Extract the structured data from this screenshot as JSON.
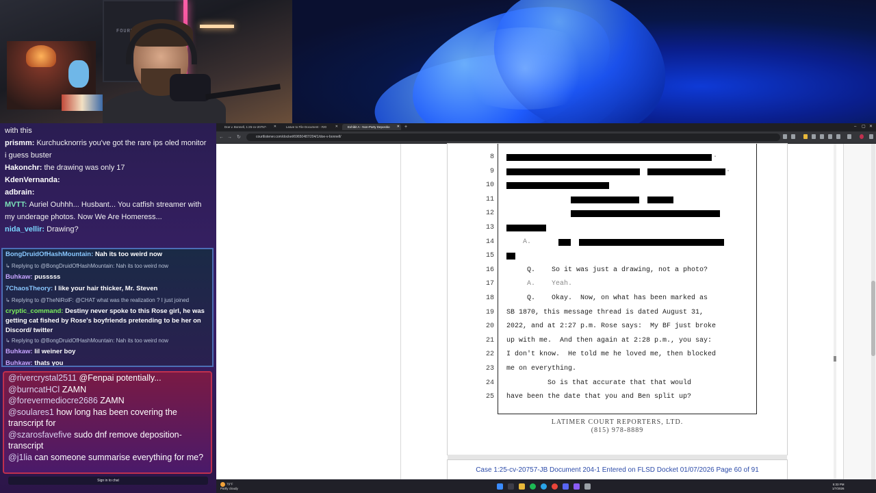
{
  "webcam": {
    "wall_text": "FOURTH SUBS"
  },
  "chat_top": [
    {
      "user": "",
      "text": "with this",
      "cls": "u-prism"
    },
    {
      "user": "prismm",
      "text": "Kurchucknorris you've got the rare ips oled monitor i guess buster",
      "cls": "u-prism",
      "wrap": true
    },
    {
      "user": "Hakonchr",
      "text": "the drawing was only 17",
      "cls": "u-prism"
    },
    {
      "user": "KdenVernanda",
      "text": "",
      "cls": "u-prism"
    },
    {
      "user": "adbrain",
      "text": "",
      "cls": "u-prism"
    },
    {
      "user": "MVTT",
      "text": "Auriel Ouhhh... Husbant... You catfish streamer with my underage photos. Now We Are Homeress...",
      "cls": "u-mint",
      "wrap": true
    },
    {
      "user": "nida_vellir",
      "text": "Drawing?",
      "cls": "u-teal"
    }
  ],
  "chat_mid": [
    {
      "user": "BongDruidOfHashMountain",
      "text": "Nah its too weird now",
      "cls": "u-azure"
    },
    {
      "reply": "Replying to @BongDruidOfHashMountain: Nah its too weird now"
    },
    {
      "user": "Buhkaw",
      "text": "pusssss",
      "cls": "u-violet"
    },
    {
      "user": "7ChaosTheory",
      "text": "I like your hair thicker, Mr. Steven",
      "cls": "u-azure"
    },
    {
      "reply": "Replying to @TheNiRolF: @CHAT what was the realization ? I just joined"
    },
    {
      "user": "cryptic_command",
      "text": "Destiny never spoke to this Rose girl, he was getting cat fished by Rose's boyfriends pretending to be her on Discord/ twitter",
      "cls": "u-green",
      "wrap": true
    },
    {
      "reply": "Replying to @BongDruidOfHashMountain: Nah its too weird now"
    },
    {
      "user": "Buhkaw",
      "text": "lil weiner boy",
      "cls": "u-violet"
    },
    {
      "user": "Buhkaw",
      "text": "thats you",
      "cls": "u-violet"
    }
  ],
  "chat_bottom": [
    {
      "handle": "@rivercrystal2511",
      "text": "@Fenpai potentially..."
    },
    {
      "handle": "@burncatHCl",
      "text": "ZAMN"
    },
    {
      "handle": "@forevermediocre2686",
      "text": "ZAMN"
    },
    {
      "handle": "@soulares1",
      "text": "how long has been covering the transcript for"
    },
    {
      "handle": "@szarosfavefive",
      "text": "sudo dnf remove deposition-transcript"
    },
    {
      "handle": "@j1lia",
      "text": "can someone summarise everything for me?"
    }
  ],
  "chat_signin": "Sign in to chat",
  "browser": {
    "tabs": [
      {
        "label": "Doe v. Bonnell, 1:25-cv-20757-",
        "active": false
      },
      {
        "label": "Leave to File Document - #20",
        "active": false
      },
      {
        "label": "Exhibit A - Non-Party Depositio",
        "active": true
      }
    ],
    "url": "courtlistener.com/docket/69650487/204/1/doe-v-bonnell/"
  },
  "transcript": {
    "lines": [
      {
        "n": "8",
        "text": "",
        "bars": [
          [
            0,
            300
          ]
        ],
        "dot": 302
      },
      {
        "n": "9",
        "text": "",
        "bars": [
          [
            0,
            195
          ],
          [
            206,
            114
          ]
        ],
        "dot": 321
      },
      {
        "n": "10",
        "text": "",
        "bars": [
          [
            0,
            150
          ]
        ]
      },
      {
        "n": "11",
        "text": "",
        "bars": [
          [
            94,
            100
          ],
          [
            206,
            38
          ]
        ]
      },
      {
        "n": "12",
        "text": "",
        "bars": [
          [
            94,
            218
          ]
        ]
      },
      {
        "n": "13",
        "text": "",
        "bars": [
          [
            0,
            58
          ]
        ]
      },
      {
        "n": "14",
        "text": "    A.",
        "grey": true,
        "bars": [
          [
            76,
            18
          ],
          [
            106,
            212
          ]
        ]
      },
      {
        "n": "15",
        "text": "",
        "bars": [
          [
            0,
            13
          ]
        ]
      },
      {
        "n": "16",
        "text": "     Q.    So it was just a drawing, not a photo?"
      },
      {
        "n": "17",
        "text": "     A.    Yeah.",
        "grey": true
      },
      {
        "n": "18",
        "text": "     Q.    Okay.  Now, on what has been marked as"
      },
      {
        "n": "19",
        "text": "SB 1870, this message thread is dated August 31,"
      },
      {
        "n": "20",
        "text": "2022, and at 2:27 p.m. Rose says:  My BF just broke"
      },
      {
        "n": "21",
        "text": "up with me.  And then again at 2:28 p.m., you say:"
      },
      {
        "n": "22",
        "text": "I don't know.  He told me he loved me, then blocked"
      },
      {
        "n": "23",
        "text": "me on everything."
      },
      {
        "n": "24",
        "text": "          So is that accurate that that would"
      },
      {
        "n": "25",
        "text": "have been the date that you and Ben split up?"
      }
    ],
    "reporter": "LATIMER COURT REPORTERS, LTD.",
    "phone": "(815) 978-8889",
    "case_header": "Case 1:25-cv-20757-JB   Document 204-1   Entered on FLSD Docket 01/07/2026   Page 60 of 91"
  },
  "taskbar": {
    "temp": "79°F",
    "weather": "Partly cloudy",
    "time": "5:33 PM",
    "date": "1/7/2026"
  },
  "colors": {
    "accent": "#2b4aa8",
    "chat_bg": "#2a1d52",
    "wallpaper": "#0e3ad6"
  }
}
